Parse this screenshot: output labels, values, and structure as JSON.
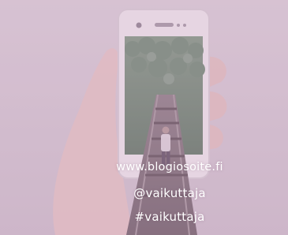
{
  "overlay": {
    "website": "www.blogiosoite.fi",
    "handle": "@vaikuttaja",
    "hashtag": "#vaikuttaja"
  },
  "colors": {
    "tint": "#c896b9",
    "text": "#ffffff"
  },
  "icons": {
    "phone_camera": "camera-icon"
  }
}
